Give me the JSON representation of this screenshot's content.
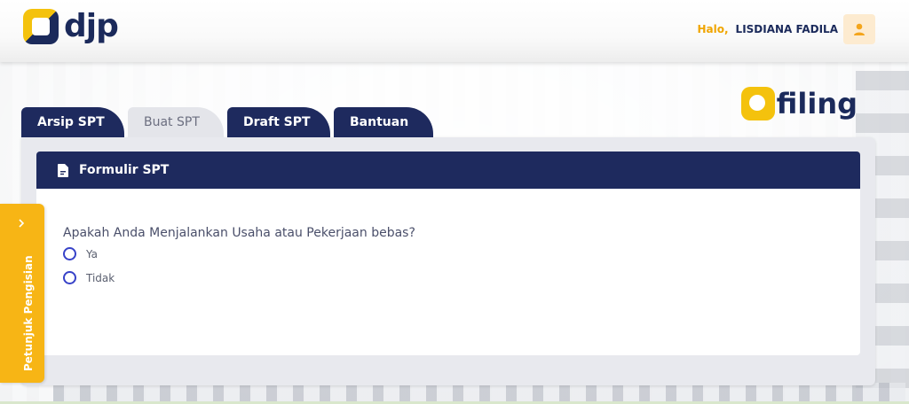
{
  "header": {
    "logo_text": "djp",
    "greeting": "Halo,",
    "user_name": "LISDIANA FADILA"
  },
  "brand": {
    "efiling_text": "filing"
  },
  "tabs": [
    {
      "label": "Arsip SPT",
      "active": false
    },
    {
      "label": "Buat SPT",
      "active": true
    },
    {
      "label": "Draft SPT",
      "active": false
    },
    {
      "label": "Bantuan",
      "active": false
    }
  ],
  "form": {
    "title": "Formulir SPT",
    "question": "Apakah Anda Menjalankan Usaha atau Pekerjaan bebas?",
    "options": [
      "Ya",
      "Tidak"
    ]
  },
  "side_tab": {
    "label": "Petunjuk Pengisian"
  },
  "colors": {
    "navy": "#1e2a5e",
    "yellow": "#f7b515",
    "radio": "#3742c8"
  },
  "icons": {
    "user": "user-icon",
    "document": "document-icon",
    "chevron": "chevron-right-icon"
  }
}
